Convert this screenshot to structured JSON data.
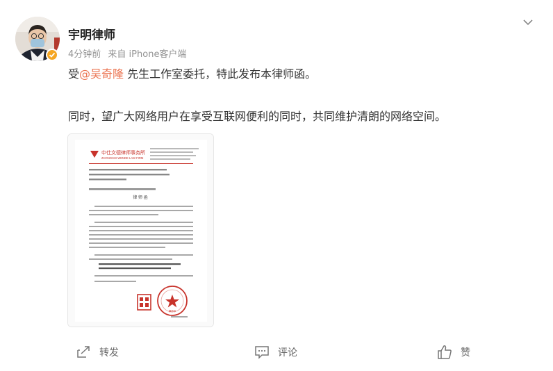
{
  "post": {
    "author": "宇明律师",
    "time": "4分钟前",
    "source": "来自 iPhone客户端",
    "text_prefix": "受",
    "mention": "@吴奇隆",
    "text_suffix": " 先生工作室委托，特此发布本律师函。",
    "text_line2": "同时，望广大网络用户在享受互联网便利的同时，共同维护清朗的网络空间。"
  },
  "document": {
    "firm_name": "中仕文德律师事务所",
    "firm_name_en": "ZHONGSHI WENDE LAW FIRM",
    "title": "律 师 函",
    "seal_text": "律师印"
  },
  "actions": {
    "repost": "转发",
    "comment": "评论",
    "like": "赞"
  },
  "colors": {
    "mention": "#eb7350",
    "verified_badge": "#f5a623",
    "doc_red": "#c8332b"
  },
  "icons": {
    "more": "chevron-down-icon",
    "repost": "repost-icon",
    "comment": "comment-icon",
    "like": "like-icon",
    "verified": "verified-badge-icon"
  }
}
